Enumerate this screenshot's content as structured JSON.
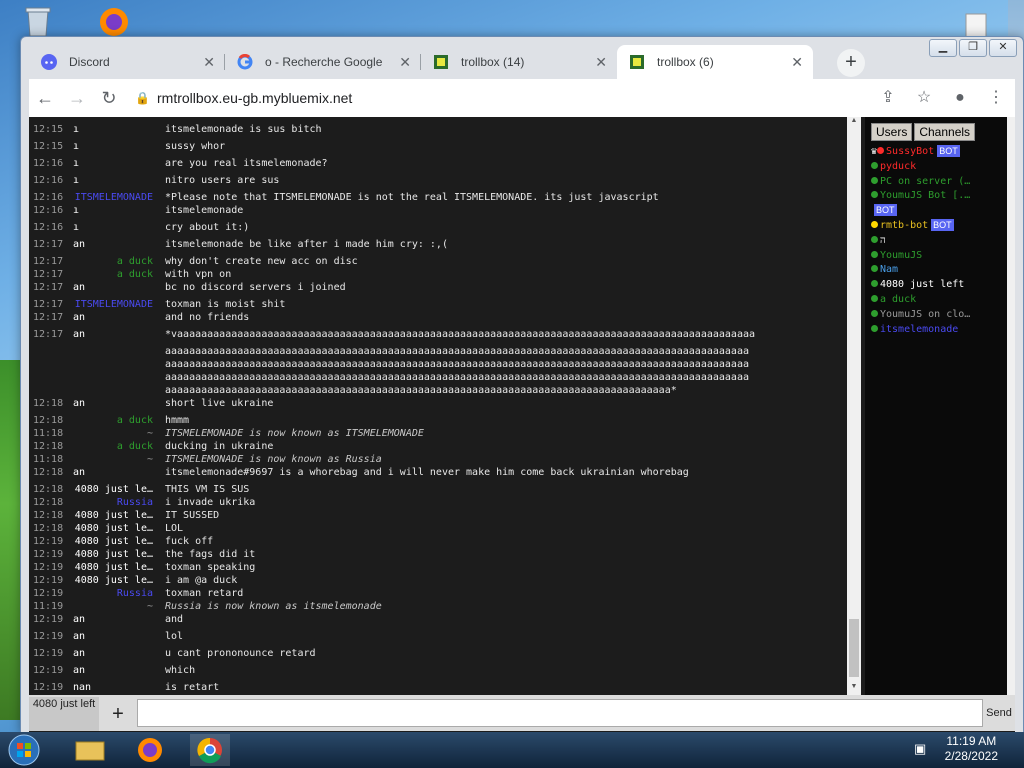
{
  "browser": {
    "tabs": [
      {
        "label": "Discord",
        "icon": "discord-icon"
      },
      {
        "label": "o - Recherche Google",
        "icon": "google-icon"
      },
      {
        "label": "trollbox (14)",
        "icon": "trollbox-icon"
      },
      {
        "label": "trollbox (6)",
        "icon": "trollbox-icon",
        "active": true
      }
    ],
    "url": "rmtrollbox.eu-gb.mybluemix.net",
    "new_tab": "+"
  },
  "chat": {
    "messages": [
      {
        "time": "12:15",
        "nick": "ı",
        "nick_color": "#ffffff",
        "text": "itsmelemonade is sus bitch"
      },
      {
        "time": "12:15",
        "nick": "ı",
        "nick_color": "#ffffff",
        "text": "sussy whor"
      },
      {
        "time": "12:16",
        "nick": "ı",
        "nick_color": "#ffffff",
        "text": "are you real itsmelemonade?"
      },
      {
        "time": "12:16",
        "nick": "ı",
        "nick_color": "#ffffff",
        "text": "nitro users are sus"
      },
      {
        "time": "12:16",
        "nick": "ITSMELEMONADE",
        "nick_color": "#4a4af0",
        "text": "*Please note that ITSMELEMONADE is not the real ITSMELEMONADE. its just javascript"
      },
      {
        "time": "12:16",
        "nick": "ı",
        "nick_color": "#ffffff",
        "text": "itsmelemonade"
      },
      {
        "time": "12:16",
        "nick": "ı",
        "nick_color": "#ffffff",
        "text": "cry about it:)"
      },
      {
        "time": "12:17",
        "nick": "an",
        "nick_color": "#ffffff",
        "text": "itsmelemonade be like after i made him cry:   :,("
      },
      {
        "time": "12:17",
        "nick": "a duck",
        "nick_color": "#2e9e2e",
        "text": "why don't create new acc on disc"
      },
      {
        "time": "12:17",
        "nick": "a duck",
        "nick_color": "#2e9e2e",
        "text": "with vpn on"
      },
      {
        "time": "12:17",
        "nick": "an",
        "nick_color": "#ffffff",
        "text": "bc no discord servers i joined"
      },
      {
        "time": "12:17",
        "nick": "ITSMELEMONADE",
        "nick_color": "#4a4af0",
        "text": "toxman is moist shit"
      },
      {
        "time": "12:17",
        "nick": "an",
        "nick_color": "#ffffff",
        "text": "and no friends"
      },
      {
        "time": "12:17",
        "nick": "an",
        "nick_color": "#ffffff",
        "text": "*vaaaaaaaaaaaaaaaaaaaaaaaaaaaaaaaaaaaaaaaaaaaaaaaaaaaaaaaaaaaaaaaaaaaaaaaaaaaaaaaaaaaaaaaaaaaaaaaa"
      },
      {
        "time": "",
        "nick": "",
        "nick_color": "#ffffff",
        "text": "aaaaaaaaaaaaaaaaaaaaaaaaaaaaaaaaaaaaaaaaaaaaaaaaaaaaaaaaaaaaaaaaaaaaaaaaaaaaaaaaaaaaaaaaaaaaaaaaa"
      },
      {
        "time": "",
        "nick": "",
        "nick_color": "#ffffff",
        "text": "aaaaaaaaaaaaaaaaaaaaaaaaaaaaaaaaaaaaaaaaaaaaaaaaaaaaaaaaaaaaaaaaaaaaaaaaaaaaaaaaaaaaaaaaaaaaaaaaa"
      },
      {
        "time": "",
        "nick": "",
        "nick_color": "#ffffff",
        "text": "aaaaaaaaaaaaaaaaaaaaaaaaaaaaaaaaaaaaaaaaaaaaaaaaaaaaaaaaaaaaaaaaaaaaaaaaaaaaaaaaaaaaaaaaaaaaaaaaa"
      },
      {
        "time": "",
        "nick": "",
        "nick_color": "#ffffff",
        "text": "aaaaaaaaaaaaaaaaaaaaaaaaaaaaaaaaaaaaaaaaaaaaaaaaaaaaaaaaaaaaaaaaaaaaaaaaaaaaaaaaaaaa*"
      },
      {
        "time": "12:18",
        "nick": "an",
        "nick_color": "#ffffff",
        "text": "short live ukraine"
      },
      {
        "time": "12:18",
        "nick": "a duck",
        "nick_color": "#2e9e2e",
        "text": "hmmm"
      },
      {
        "time": "11:18",
        "nick": "~",
        "nick_color": "#9a9a9a",
        "system": true,
        "text": "ITSMELEMONADE is now known as ITSMELEMONADE"
      },
      {
        "time": "12:18",
        "nick": "a duck",
        "nick_color": "#2e9e2e",
        "text": "ducking in ukraine"
      },
      {
        "time": "11:18",
        "nick": "~",
        "nick_color": "#9a9a9a",
        "system": true,
        "text": "ITSMELEMONADE   is now known as Russia"
      },
      {
        "time": "12:18",
        "nick": "an",
        "nick_color": "#ffffff",
        "text": "itsmelemonade#9697 is a whorebag and i will never make him come back ukrainian whorebag"
      },
      {
        "time": "12:18",
        "nick": "4080 just le…",
        "nick_color": "#ffffff",
        "text": "THIS VM IS SUS"
      },
      {
        "time": "12:18",
        "nick": "Russia",
        "nick_color": "#4a4af0",
        "text": "i invade ukrika"
      },
      {
        "time": "12:18",
        "nick": "4080 just le…",
        "nick_color": "#ffffff",
        "text": "IT SUSSED"
      },
      {
        "time": "12:18",
        "nick": "4080 just le…",
        "nick_color": "#ffffff",
        "text": "LOL"
      },
      {
        "time": "12:19",
        "nick": "4080 just le…",
        "nick_color": "#ffffff",
        "text": "fuck off"
      },
      {
        "time": "12:19",
        "nick": "4080 just le…",
        "nick_color": "#ffffff",
        "text": "the fags did it"
      },
      {
        "time": "12:19",
        "nick": "4080 just le…",
        "nick_color": "#ffffff",
        "text": "toxman speaking"
      },
      {
        "time": "12:19",
        "nick": "4080 just le…",
        "nick_color": "#ffffff",
        "text": "i am @a duck"
      },
      {
        "time": "12:19",
        "nick": "Russia",
        "nick_color": "#4a4af0",
        "text": "toxman retard"
      },
      {
        "time": "11:19",
        "nick": "~",
        "nick_color": "#9a9a9a",
        "system": true,
        "text": "Russia is now known as itsmelemonade"
      },
      {
        "time": "12:19",
        "nick": "an",
        "nick_color": "#ffffff",
        "text": "and"
      },
      {
        "time": "12:19",
        "nick": "an",
        "nick_color": "#ffffff",
        "text": "lol"
      },
      {
        "time": "12:19",
        "nick": "an",
        "nick_color": "#ffffff",
        "text": "u cant prononounce retard"
      },
      {
        "time": "12:19",
        "nick": "an",
        "nick_color": "#ffffff",
        "text": "which"
      },
      {
        "time": "12:19",
        "nick": "nan",
        "nick_color": "#ffffff",
        "text": "is retart"
      }
    ]
  },
  "sidebar": {
    "tabs": [
      "Users",
      "Channels"
    ],
    "users": [
      {
        "name": "SussyBot",
        "color": "#ff2a2a",
        "dot": "#ff2a2a",
        "crown": "♛",
        "bot": "BOT"
      },
      {
        "name": "pyduck",
        "color": "#ff2a2a",
        "dot": "#2e9e2e"
      },
      {
        "name": "PC on server (…",
        "color": "#2e9e2e",
        "dot": "#2e9e2e"
      },
      {
        "name": "YoumuJS Bot [.…",
        "color": "#2e9e2e",
        "dot": "#2e9e2e"
      },
      {
        "name": "",
        "color": "#ffffff",
        "dot": "",
        "bot": "BOT"
      },
      {
        "name": "rmtb-bot",
        "color": "#e8c020",
        "dot": "#ffd700",
        "bot": "BOT"
      },
      {
        "name": "ה",
        "color": "#ffffff",
        "dot": "#2e9e2e"
      },
      {
        "name": "YoumuJS",
        "color": "#2e9e2e",
        "dot": "#2e9e2e"
      },
      {
        "name": "Nam",
        "color": "#4a9ee8",
        "dot": "#2e9e2e"
      },
      {
        "name": "4080 just left",
        "color": "#ffffff",
        "dot": "#2e9e2e"
      },
      {
        "name": "a duck",
        "color": "#2e9e2e",
        "dot": "#2e9e2e"
      },
      {
        "name": "YoumuJS on clo…",
        "color": "#9a9a9a",
        "dot": "#2e9e2e"
      },
      {
        "name": "itsmelemonade",
        "color": "#4a4af0",
        "dot": "#2e9e2e"
      }
    ]
  },
  "input": {
    "channel": "4080 just left",
    "plus": "+",
    "value": "",
    "send": "Send"
  },
  "taskbar": {
    "time": "11:19 AM",
    "date": "2/28/2022"
  }
}
